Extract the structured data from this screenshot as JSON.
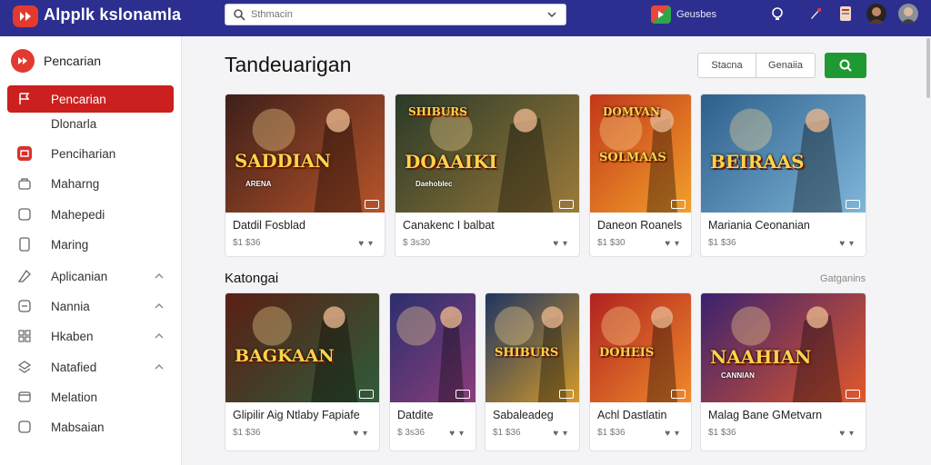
{
  "header": {
    "app_title": "Alpplk kslonamla",
    "search_placeholder": "Sthmacin",
    "store_label": "Geusbes"
  },
  "sidebar": {
    "header_label": "Pencarian",
    "items": [
      {
        "label": "Pencarian",
        "icon": "flag-icon",
        "active": true,
        "caret": false
      },
      {
        "label": "Dlonarla",
        "icon": "",
        "active": false,
        "caret": false
      },
      {
        "label": "Penciharian",
        "icon": "app-badge-icon",
        "active": false,
        "caret": false
      },
      {
        "label": "Maharng",
        "icon": "bag-icon",
        "active": false,
        "caret": false
      },
      {
        "label": "Mahepedi",
        "icon": "square-icon",
        "active": false,
        "caret": false
      },
      {
        "label": "Maring",
        "icon": "device-icon",
        "active": false,
        "caret": false
      },
      {
        "label": "Aplicanian",
        "icon": "tag-icon",
        "active": false,
        "caret": true
      },
      {
        "label": "Nannia",
        "icon": "list-icon",
        "active": false,
        "caret": true
      },
      {
        "label": "Hkaben",
        "icon": "grid-icon",
        "active": false,
        "caret": true
      },
      {
        "label": "Natafied",
        "icon": "layers-icon",
        "active": false,
        "caret": true
      },
      {
        "label": "Melation",
        "icon": "window-icon",
        "active": false,
        "caret": false
      },
      {
        "label": "Mabsaian",
        "icon": "square-icon",
        "active": false,
        "caret": false
      }
    ]
  },
  "main": {
    "title": "Tandeuarigan",
    "filter_buttons": [
      "Stacna",
      "Genaiia"
    ],
    "section2_title": "Katongai",
    "section2_link": "Gatganins"
  },
  "row1": [
    {
      "title": "Datdil Fosblad",
      "price": "$1 $36",
      "art_text": "SADDIAN",
      "art_sub": "ARENA",
      "colors": [
        "#3d1f1a",
        "#b8542a"
      ]
    },
    {
      "title": "Canakenc I balbat",
      "price": "$ 3s30",
      "art_text": "DOAAIKI",
      "art_sub": "Daehoblec",
      "top_text": "SHIBURS",
      "colors": [
        "#2a3a28",
        "#9b7a3a"
      ]
    },
    {
      "title": "Daneon Roanels",
      "price": "$1 $30",
      "art_text": "SOLMAAS",
      "art_sub": "",
      "top_text": "DOMVAN",
      "colors": [
        "#c2371a",
        "#f2a02a"
      ]
    },
    {
      "title": "Mariania Ceonanian",
      "price": "$1 $36",
      "art_text": "BEIRAAS",
      "art_sub": "",
      "colors": [
        "#2e5f8c",
        "#7fb6d8"
      ]
    }
  ],
  "row2": [
    {
      "title": "Glipilir Aig Ntlaby Fapiafe",
      "price": "$1 $36",
      "art_text": "BAGKAAN",
      "art_sub": "",
      "colors": [
        "#5a1f14",
        "#2f5c3a"
      ]
    },
    {
      "title": "Datdite",
      "price": "$ 3s36",
      "art_text": "",
      "art_sub": "",
      "colors": [
        "#2b2f6e",
        "#8b3d7a"
      ]
    },
    {
      "title": "Sabaleadeg",
      "price": "$1 $36",
      "art_text": "SHIBURS",
      "art_sub": "",
      "colors": [
        "#1f3560",
        "#d49a2a"
      ]
    },
    {
      "title": "Achl Dastlatin",
      "price": "$1 $36",
      "art_text": "DOHEIS",
      "art_sub": "",
      "colors": [
        "#b02220",
        "#f08a2a"
      ]
    },
    {
      "title": "Malag Bane GMetvarn",
      "price": "$1 $36",
      "art_text": "NAAHIAN",
      "art_sub": "CANNIAN",
      "colors": [
        "#3a2170",
        "#e2582a"
      ]
    }
  ]
}
